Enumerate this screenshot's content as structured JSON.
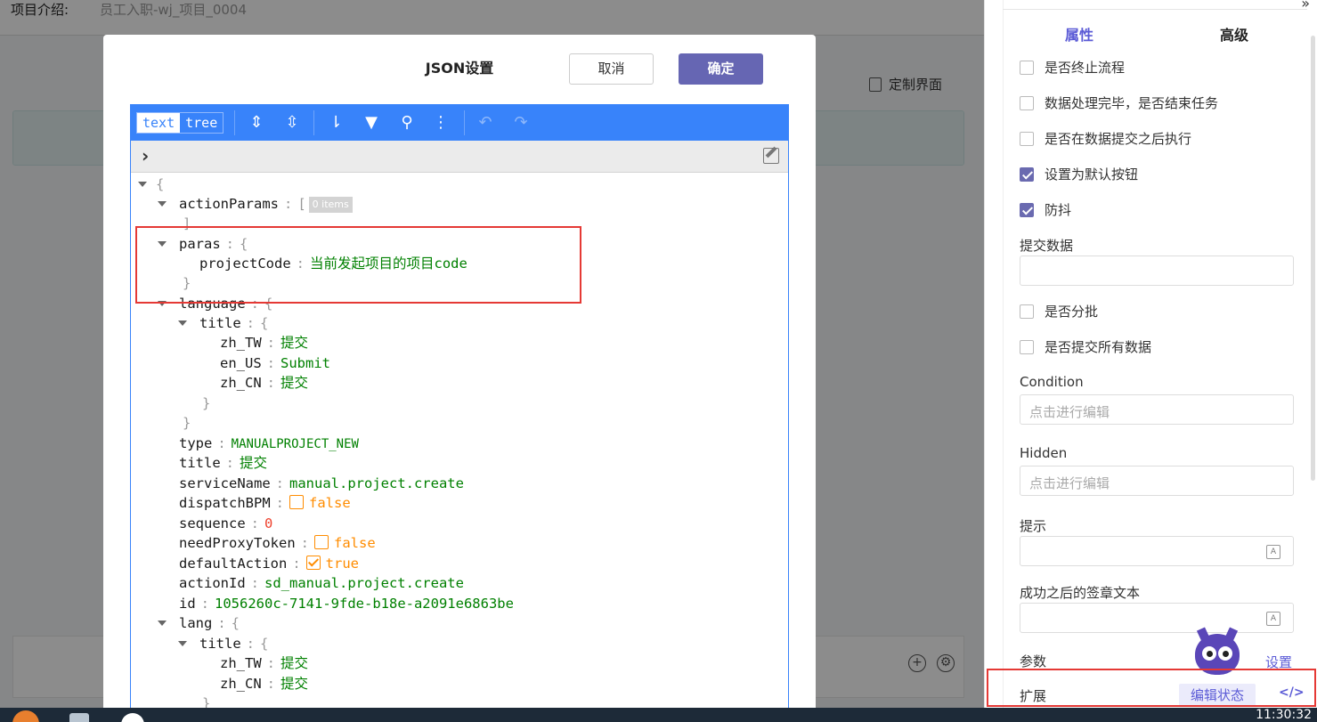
{
  "background": {
    "project_label": "项目介绍:",
    "project_value": "员工入职-wj_项目_0004",
    "custom_ui_label": "定制界面"
  },
  "modal": {
    "title": "JSON设置",
    "cancel_label": "取消",
    "ok_label": "确定",
    "editor": {
      "mode_text": "text",
      "mode_tree": "tree",
      "empty_badge": "0 items",
      "rows": {
        "actionParams_key": "actionParams",
        "paras_key": "paras",
        "projectCode_key": "projectCode",
        "projectCode_val": "当前发起项目的项目code",
        "language_key": "language",
        "title_key": "title",
        "zh_TW_key": "zh_TW",
        "zh_TW_val": "提交",
        "en_US_key": "en_US",
        "en_US_val": "Submit",
        "zh_CN_key": "zh_CN",
        "zh_CN_val": "提交",
        "type_key": "type",
        "type_val": "MANUALPROJECT_NEW",
        "title2_key": "title",
        "title2_val": "提交",
        "serviceName_key": "serviceName",
        "serviceName_val": "manual.project.create",
        "dispatchBPM_key": "dispatchBPM",
        "dispatchBPM_val": "false",
        "sequence_key": "sequence",
        "sequence_val": "0",
        "needProxyToken_key": "needProxyToken",
        "needProxyToken_val": "false",
        "defaultAction_key": "defaultAction",
        "defaultAction_val": "true",
        "actionId_key": "actionId",
        "actionId_val": "sd_manual.project.create",
        "id_key": "id",
        "id_val": "1056260c-7141-9fde-b18e-a2091e6863be",
        "lang_key": "lang",
        "lang_title_key": "title",
        "lang_zh_TW_key": "zh_TW",
        "lang_zh_TW_val": "提交",
        "lang_zh_CN_key": "zh_CN",
        "lang_zh_CN_val": "提交"
      }
    }
  },
  "right_panel": {
    "tab_props": "属性",
    "tab_advanced": "高级",
    "cb_terminate": "是否终止流程",
    "cb_end_task": "数据处理完毕，是否结束任务",
    "cb_after_submit": "是否在数据提交之后执行",
    "cb_default_button": "设置为默认按钮",
    "cb_debounce": "防抖",
    "submit_data_label": "提交数据",
    "cb_batch": "是否分批",
    "cb_submit_all": "是否提交所有数据",
    "condition_label": "Condition",
    "condition_placeholder": "点击进行编辑",
    "hidden_label": "Hidden",
    "hidden_placeholder": "点击进行编辑",
    "hint_label": "提示",
    "sign_text_label": "成功之后的签章文本",
    "params_label": "参数",
    "params_link": "设置",
    "extend_label": "扩展",
    "edit_status": "编辑状态",
    "code_icon_text": "</>"
  },
  "taskbar": {
    "clock": "11:30:32"
  },
  "colors": {
    "accent": "#5b5bd6",
    "editor_blue": "#3883fa",
    "string_green": "#008000",
    "bool_orange": "#ff8c00",
    "number_red": "#ee422e",
    "highlight_red": "#e53935"
  }
}
